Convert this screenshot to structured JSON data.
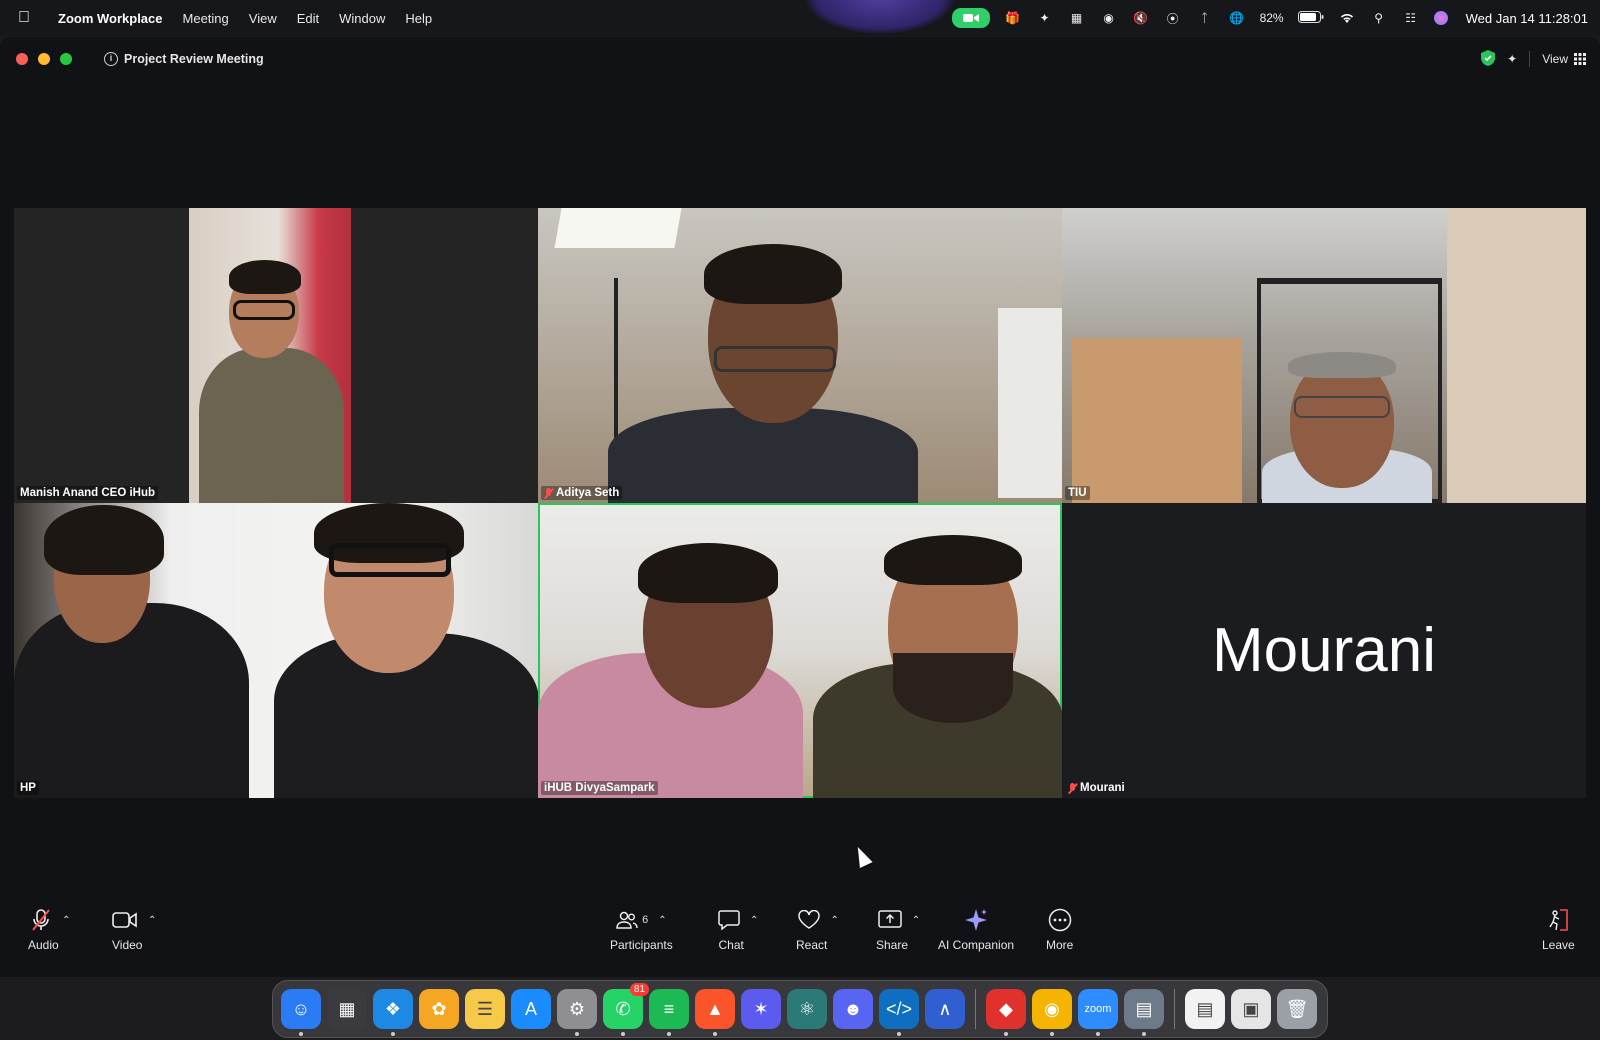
{
  "menubar": {
    "app_name": "Zoom Workplace",
    "menus": [
      "Meeting",
      "View",
      "Edit",
      "Window",
      "Help"
    ],
    "battery": "82%",
    "datetime": "Wed Jan 14  11:28:01",
    "icons": [
      "apple-icon",
      "zoom-camera-icon",
      "gift-icon",
      "sparkle-icon",
      "split-view-icon",
      "screen-record-icon",
      "mute-icon",
      "airdrop-icon",
      "bluetooth-icon",
      "vpn-icon",
      "battery-icon",
      "wifi-icon",
      "search-icon",
      "control-center-icon",
      "siri-icon"
    ]
  },
  "window": {
    "meeting_title": "Project Review Meeting",
    "view_label": "View"
  },
  "participants": [
    {
      "name": "Manish Anand CEO iHub",
      "muted": false,
      "active": false,
      "video": true
    },
    {
      "name": "Aditya Seth",
      "muted": true,
      "active": false,
      "video": true
    },
    {
      "name": "TIU",
      "muted": false,
      "active": false,
      "video": true
    },
    {
      "name": "HP",
      "muted": false,
      "active": false,
      "video": true
    },
    {
      "name": "iHUB DivyaSampark",
      "muted": false,
      "active": true,
      "video": true
    },
    {
      "name": "Mourani",
      "muted": true,
      "active": false,
      "video": false,
      "display_name": "Mourani"
    }
  ],
  "toolbar": {
    "audio_label": "Audio",
    "video_label": "Video",
    "participants_label": "Participants",
    "participants_count": "6",
    "chat_label": "Chat",
    "react_label": "React",
    "share_label": "Share",
    "ai_label": "AI Companion",
    "more_label": "More",
    "leave_label": "Leave"
  },
  "dock": {
    "apps": [
      {
        "name": "finder",
        "color": "#2a7bf4",
        "running": true
      },
      {
        "name": "launchpad",
        "color": "#3a3a3f",
        "running": false
      },
      {
        "name": "safari",
        "color": "#1e88e5",
        "running": true
      },
      {
        "name": "photos",
        "color": "#f5a623",
        "running": false
      },
      {
        "name": "notes",
        "color": "#f7c948",
        "running": false
      },
      {
        "name": "app-store",
        "color": "#1a8cff",
        "running": false
      },
      {
        "name": "system-settings",
        "color": "#8e8e93",
        "running": true
      },
      {
        "name": "whatsapp",
        "color": "#25d366",
        "running": true,
        "badge": "81"
      },
      {
        "name": "spotify",
        "color": "#1db954",
        "running": true
      },
      {
        "name": "brave",
        "color": "#fb542b",
        "running": true
      },
      {
        "name": "perplexity",
        "color": "#5b5bf0",
        "running": false
      },
      {
        "name": "chatgpt",
        "color": "#2b7a78",
        "running": false
      },
      {
        "name": "discord",
        "color": "#5865f2",
        "running": false
      },
      {
        "name": "vscode",
        "color": "#0e6fc1",
        "running": true
      },
      {
        "name": "arc",
        "color": "#2f5fd0",
        "running": false
      },
      {
        "name": "anydesk",
        "color": "#e0312c",
        "running": true
      },
      {
        "name": "chrome",
        "color": "#f4b400",
        "running": true
      },
      {
        "name": "zoom",
        "color": "#2d8cff",
        "running": true
      },
      {
        "name": "disk-utility",
        "color": "#6c7a89",
        "running": true
      },
      {
        "name": "document",
        "color": "#f2f2f2",
        "running": false
      },
      {
        "name": "image-file",
        "color": "#e6e6e6",
        "running": false
      },
      {
        "name": "trash",
        "color": "#9aa0a6",
        "running": false
      }
    ]
  }
}
